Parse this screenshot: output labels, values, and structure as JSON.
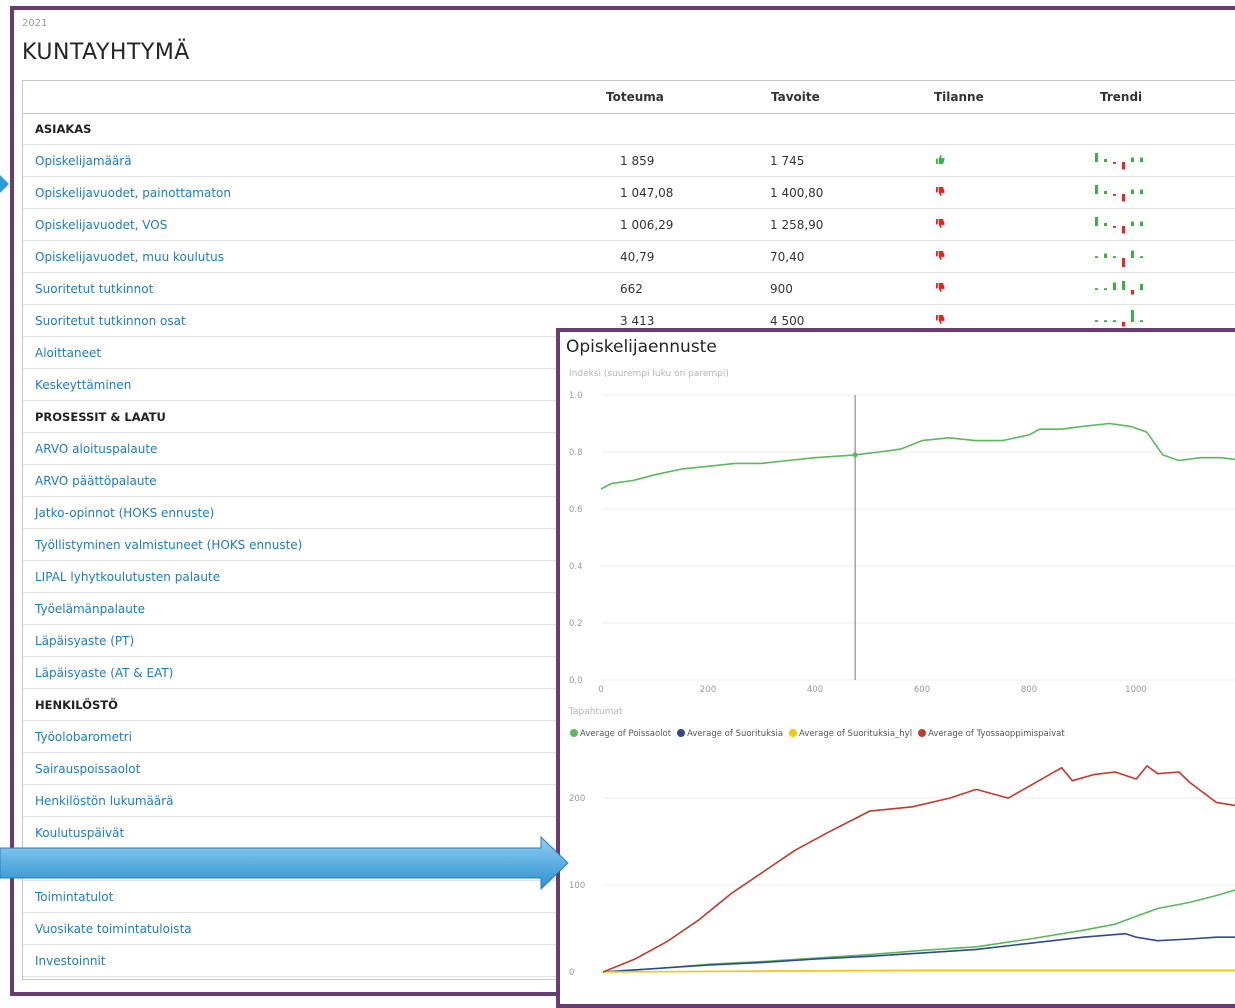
{
  "year": "2021",
  "title": "KUNTAYHTYMÄ",
  "columns": {
    "toteuma": "Toteuma",
    "tavoite": "Tavoite",
    "tilanne": "Tilanne",
    "trendi": "Trendi"
  },
  "rows": [
    {
      "type": "section",
      "label": "ASIAKAS"
    },
    {
      "type": "metric",
      "label": "Opiskelijamäärä",
      "toteuma": "1 859",
      "tavoite": "1 745",
      "status": "up",
      "trend": [
        6,
        2,
        -1,
        -5,
        3,
        3
      ]
    },
    {
      "type": "metric",
      "label": "Opiskelijavuodet, painottamaton",
      "toteuma": "1 047,08",
      "tavoite": "1 400,80",
      "status": "down",
      "trend": [
        6,
        2,
        -1,
        -5,
        3,
        3
      ]
    },
    {
      "type": "metric",
      "label": "Opiskelijavuodet, VOS",
      "toteuma": "1 006,29",
      "tavoite": "1 258,90",
      "status": "down",
      "trend": [
        6,
        2,
        -1,
        -5,
        3,
        3
      ]
    },
    {
      "type": "metric",
      "label": "Opiskelijavuodet, muu koulutus",
      "toteuma": "40,79",
      "tavoite": "70,40",
      "status": "down",
      "trend": [
        1,
        3,
        1,
        -6,
        5,
        1
      ]
    },
    {
      "type": "metric",
      "label": "Suoritetut tutkinnot",
      "toteuma": "662",
      "tavoite": "900",
      "status": "down",
      "trend": [
        1,
        1,
        5,
        6,
        -3,
        4
      ]
    },
    {
      "type": "metric",
      "label": "Suoritetut tutkinnon osat",
      "toteuma": "3 413",
      "tavoite": "4 500",
      "status": "down",
      "trend": [
        1,
        1,
        1,
        -3,
        8,
        0
      ]
    },
    {
      "type": "metric",
      "label": "Aloittaneet"
    },
    {
      "type": "metric",
      "label": "Keskeyttäminen"
    },
    {
      "type": "section",
      "label": "PROSESSIT & LAATU"
    },
    {
      "type": "metric",
      "label": "ARVO aloituspalaute"
    },
    {
      "type": "metric",
      "label": "ARVO päättöpalaute"
    },
    {
      "type": "metric",
      "label": "Jatko-opinnot (HOKS ennuste)"
    },
    {
      "type": "metric",
      "label": "Työllistyminen valmistuneet (HOKS ennuste)"
    },
    {
      "type": "metric",
      "label": "LIPAL lyhytkoulutusten palaute"
    },
    {
      "type": "metric",
      "label": "Työelämänpalaute"
    },
    {
      "type": "metric",
      "label": "Läpäisyaste (PT)"
    },
    {
      "type": "metric",
      "label": "Läpäisyaste (AT & EAT)"
    },
    {
      "type": "section",
      "label": "HENKILÖSTÖ"
    },
    {
      "type": "metric",
      "label": "Työolobarometri"
    },
    {
      "type": "metric",
      "label": "Sairauspoissaolot"
    },
    {
      "type": "metric",
      "label": "Henkilöstön lukumäärä"
    },
    {
      "type": "metric",
      "label": "Koulutuspäivät"
    },
    {
      "type": "metric",
      "label": ""
    },
    {
      "type": "metric",
      "label": "Toimintatulot"
    },
    {
      "type": "metric",
      "label": "Vuosikate toimintatuloista"
    },
    {
      "type": "metric",
      "label": "Investoinnit"
    }
  ],
  "popup": {
    "title": "Opiskelijaennuste",
    "chart1_subtitle": "Indeksi (suurempi luku on parempi)",
    "chart2_subtitle": "Tapahtumat"
  },
  "colors": {
    "frame": "#6a3c73",
    "link": "#1f7bbf",
    "good": "#3cb043",
    "bad": "#e8261f",
    "arrow": "#2e9bd6"
  },
  "chart_data": [
    {
      "type": "line",
      "title": "",
      "ylabel": "Indeksi (suurempi luku on parempi)",
      "xlim": [
        0,
        1200
      ],
      "ylim": [
        0,
        1.0
      ],
      "xticks": [
        0,
        200,
        400,
        600,
        800,
        1000,
        1200
      ],
      "xtick_labels": [
        "0",
        "200",
        "400",
        "600",
        "800",
        "1000",
        "12"
      ],
      "yticks": [
        0,
        0.2,
        0.4,
        0.6,
        0.8,
        1.0
      ],
      "ytick_labels": [
        "0.0",
        "0.2",
        "0.4",
        "0.6",
        "0.8",
        "1.0"
      ],
      "marker_x": 475,
      "series": [
        {
          "color": "#5cb85c",
          "points": [
            [
              0,
              0.67
            ],
            [
              20,
              0.69
            ],
            [
              60,
              0.7
            ],
            [
              100,
              0.72
            ],
            [
              150,
              0.74
            ],
            [
              200,
              0.75
            ],
            [
              250,
              0.76
            ],
            [
              300,
              0.76
            ],
            [
              350,
              0.77
            ],
            [
              400,
              0.78
            ],
            [
              475,
              0.79
            ],
            [
              520,
              0.8
            ],
            [
              560,
              0.81
            ],
            [
              600,
              0.84
            ],
            [
              650,
              0.85
            ],
            [
              700,
              0.84
            ],
            [
              750,
              0.84
            ],
            [
              800,
              0.86
            ],
            [
              820,
              0.88
            ],
            [
              860,
              0.88
            ],
            [
              900,
              0.89
            ],
            [
              950,
              0.9
            ],
            [
              990,
              0.89
            ],
            [
              1020,
              0.87
            ],
            [
              1050,
              0.79
            ],
            [
              1080,
              0.77
            ],
            [
              1120,
              0.78
            ],
            [
              1160,
              0.78
            ],
            [
              1200,
              0.77
            ]
          ]
        }
      ]
    },
    {
      "type": "line",
      "title": "Tapahtumat",
      "ylim": [
        0,
        230
      ],
      "yticks": [
        0,
        100,
        200
      ],
      "ytick_labels": [
        "0",
        "100",
        "200"
      ],
      "xlim": [
        0,
        1200
      ],
      "series": [
        {
          "name": "Average of Poissaolot",
          "color": "#5cb85c",
          "points": [
            [
              0,
              0
            ],
            [
              100,
              4
            ],
            [
              200,
              9
            ],
            [
              300,
              12
            ],
            [
              400,
              16
            ],
            [
              500,
              20
            ],
            [
              600,
              25
            ],
            [
              700,
              29
            ],
            [
              800,
              38
            ],
            [
              900,
              48
            ],
            [
              960,
              55
            ],
            [
              1000,
              64
            ],
            [
              1040,
              73
            ],
            [
              1100,
              80
            ],
            [
              1150,
              88
            ],
            [
              1200,
              97
            ]
          ]
        },
        {
          "name": "Average of Suorituksia",
          "color": "#2f4a8c",
          "points": [
            [
              0,
              0
            ],
            [
              100,
              4
            ],
            [
              200,
              8
            ],
            [
              300,
              11
            ],
            [
              400,
              15
            ],
            [
              500,
              18
            ],
            [
              600,
              22
            ],
            [
              700,
              26
            ],
            [
              800,
              33
            ],
            [
              900,
              40
            ],
            [
              980,
              44
            ],
            [
              1000,
              40
            ],
            [
              1040,
              36
            ],
            [
              1100,
              38
            ],
            [
              1150,
              40
            ],
            [
              1200,
              40
            ]
          ]
        },
        {
          "name": "Average of Suorituksia_hyl",
          "color": "#f2c811",
          "points": [
            [
              0,
              0
            ],
            [
              300,
              1
            ],
            [
              600,
              2
            ],
            [
              900,
              2
            ],
            [
              1200,
              2
            ]
          ]
        },
        {
          "name": "Average of Tyossaoppimispaivat",
          "color": "#c0392b",
          "points": [
            [
              0,
              0
            ],
            [
              60,
              15
            ],
            [
              120,
              35
            ],
            [
              180,
              60
            ],
            [
              240,
              90
            ],
            [
              300,
              115
            ],
            [
              360,
              140
            ],
            [
              420,
              160
            ],
            [
              500,
              185
            ],
            [
              580,
              190
            ],
            [
              650,
              200
            ],
            [
              700,
              210
            ],
            [
              760,
              200
            ],
            [
              800,
              214
            ],
            [
              860,
              235
            ],
            [
              880,
              220
            ],
            [
              920,
              227
            ],
            [
              960,
              230
            ],
            [
              1000,
              222
            ],
            [
              1020,
              237
            ],
            [
              1040,
              228
            ],
            [
              1080,
              230
            ],
            [
              1100,
              218
            ],
            [
              1150,
              195
            ],
            [
              1200,
              190
            ]
          ]
        }
      ]
    }
  ]
}
